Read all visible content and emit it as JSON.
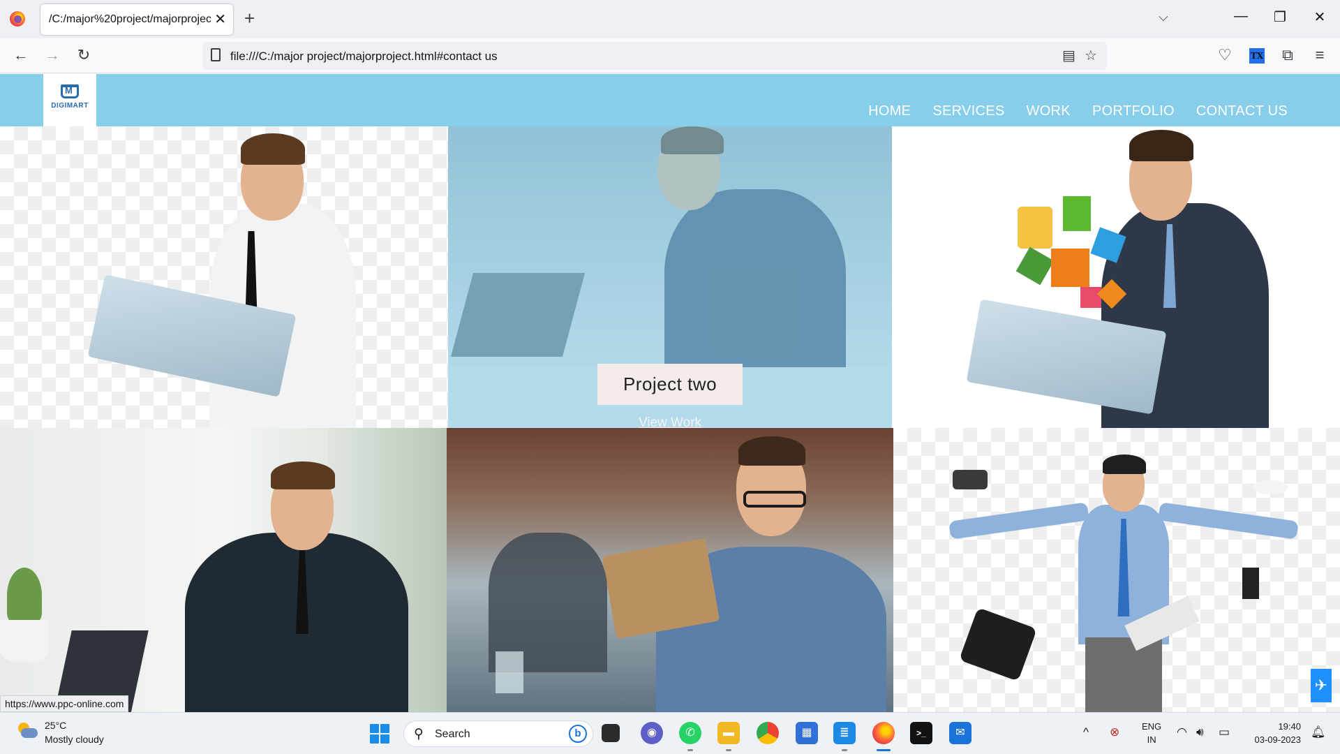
{
  "browser": {
    "tab_title": "/C:/major%20project/majorproject.",
    "url": "file:///C:/major project/majorproject.html#contact us",
    "status_url": "https://www.ppc-online.com",
    "extension_badge": "TX"
  },
  "site": {
    "logo_text": "DIGIMART",
    "nav": [
      "HOME",
      "SERVICES",
      "WORK",
      "PORTFOLIO",
      "CONTACT US"
    ],
    "hover_project": {
      "title": "Project two",
      "link": "View Work"
    },
    "accent_color": "#87ceeb"
  },
  "taskbar": {
    "temperature": "25°C",
    "weather": "Mostly cloudy",
    "search_placeholder": "Search",
    "language_line1": "ENG",
    "language_line2": "IN",
    "time": "19:40",
    "date": "03-09-2023"
  }
}
